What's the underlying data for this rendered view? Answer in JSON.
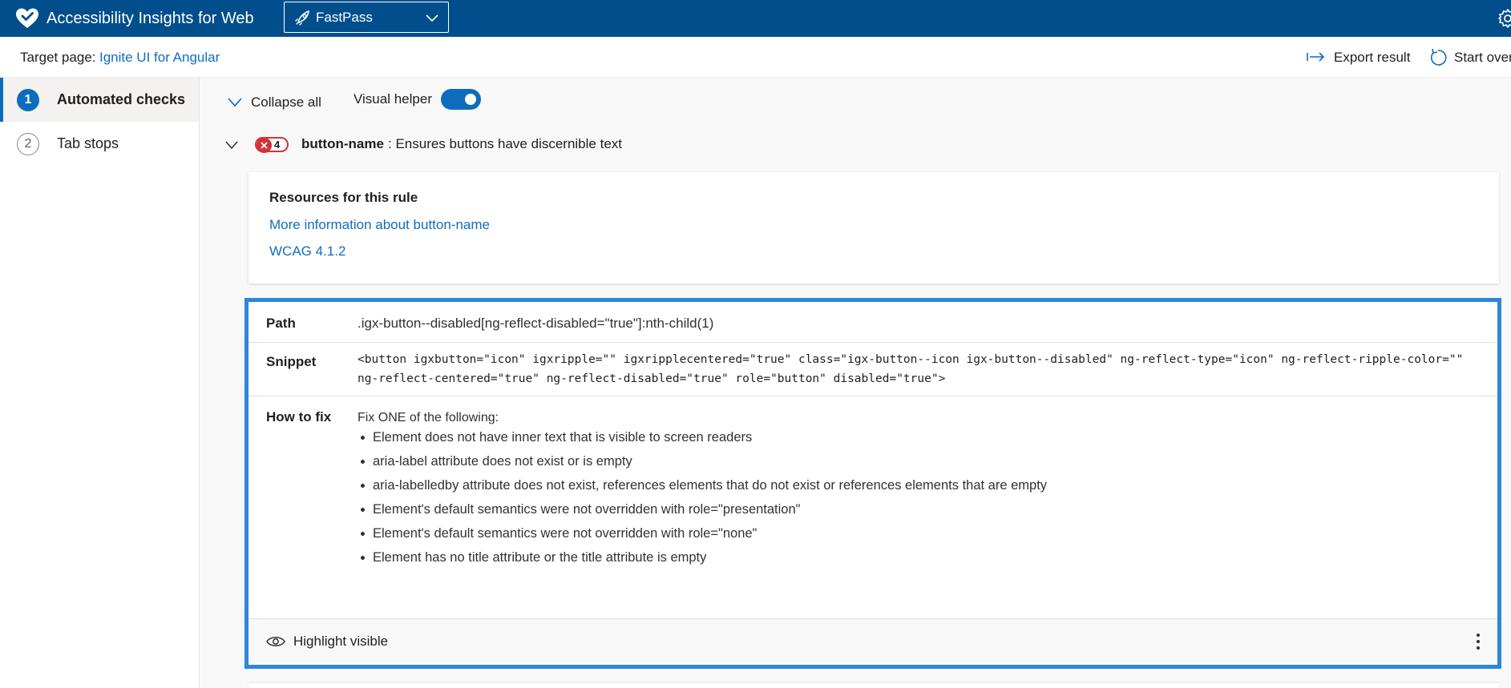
{
  "header": {
    "app_title": "Accessibility Insights for Web",
    "mode_selected": "FastPass",
    "logo_icon": "heart-check-icon",
    "mode_icon": "rocket-icon",
    "settings_icon": "gear-icon",
    "brand_color": "#004e8c"
  },
  "command_bar": {
    "target_label": "Target page:",
    "target_link": "Ignite UI for Angular",
    "export_label": "Export result",
    "start_over_label": "Start over"
  },
  "nav": {
    "items": [
      {
        "number": "1",
        "label": "Automated checks",
        "active": true
      },
      {
        "number": "2",
        "label": "Tab stops",
        "active": false
      }
    ]
  },
  "toolbar": {
    "collapse_label": "Collapse all",
    "visual_helper_label": "Visual helper",
    "visual_helper_on": true
  },
  "rule": {
    "failure_count": "4",
    "name": "button-name",
    "description": ": Ensures buttons have discernible text",
    "status_color": "#d13438"
  },
  "resources": {
    "title": "Resources for this rule",
    "links": [
      "More information about button-name",
      "WCAG 4.1.2"
    ]
  },
  "failure": {
    "path_key": "Path",
    "path_value": ".igx-button--disabled[ng-reflect-disabled=\"true\"]:nth-child(1)",
    "snippet_key": "Snippet",
    "snippet_value": "<button igxbutton=\"icon\" igxripple=\"\" igxripplecentered=\"true\" class=\"igx-button--icon igx-button--disabled\" ng-reflect-type=\"icon\" ng-reflect-ripple-color=\"\" ng-reflect-centered=\"true\" ng-reflect-disabled=\"true\" role=\"button\" disabled=\"true\">",
    "fix_key": "How to fix",
    "fix_intro": "Fix ONE of the following:",
    "fix_items": [
      "Element does not have inner text that is visible to screen readers",
      "aria-label attribute does not exist or is empty",
      "aria-labelledby attribute does not exist, references elements that do not exist or references elements that are empty",
      "Element's default semantics were not overridden with role=\"presentation\"",
      "Element's default semantics were not overridden with role=\"none\"",
      "Element has no title attribute or the title attribute is empty"
    ],
    "highlight_label": "Highlight visible",
    "highlight_icon": "eye-icon",
    "more_icon": "more-vertical-icon",
    "focus_color": "#2b88d8"
  }
}
